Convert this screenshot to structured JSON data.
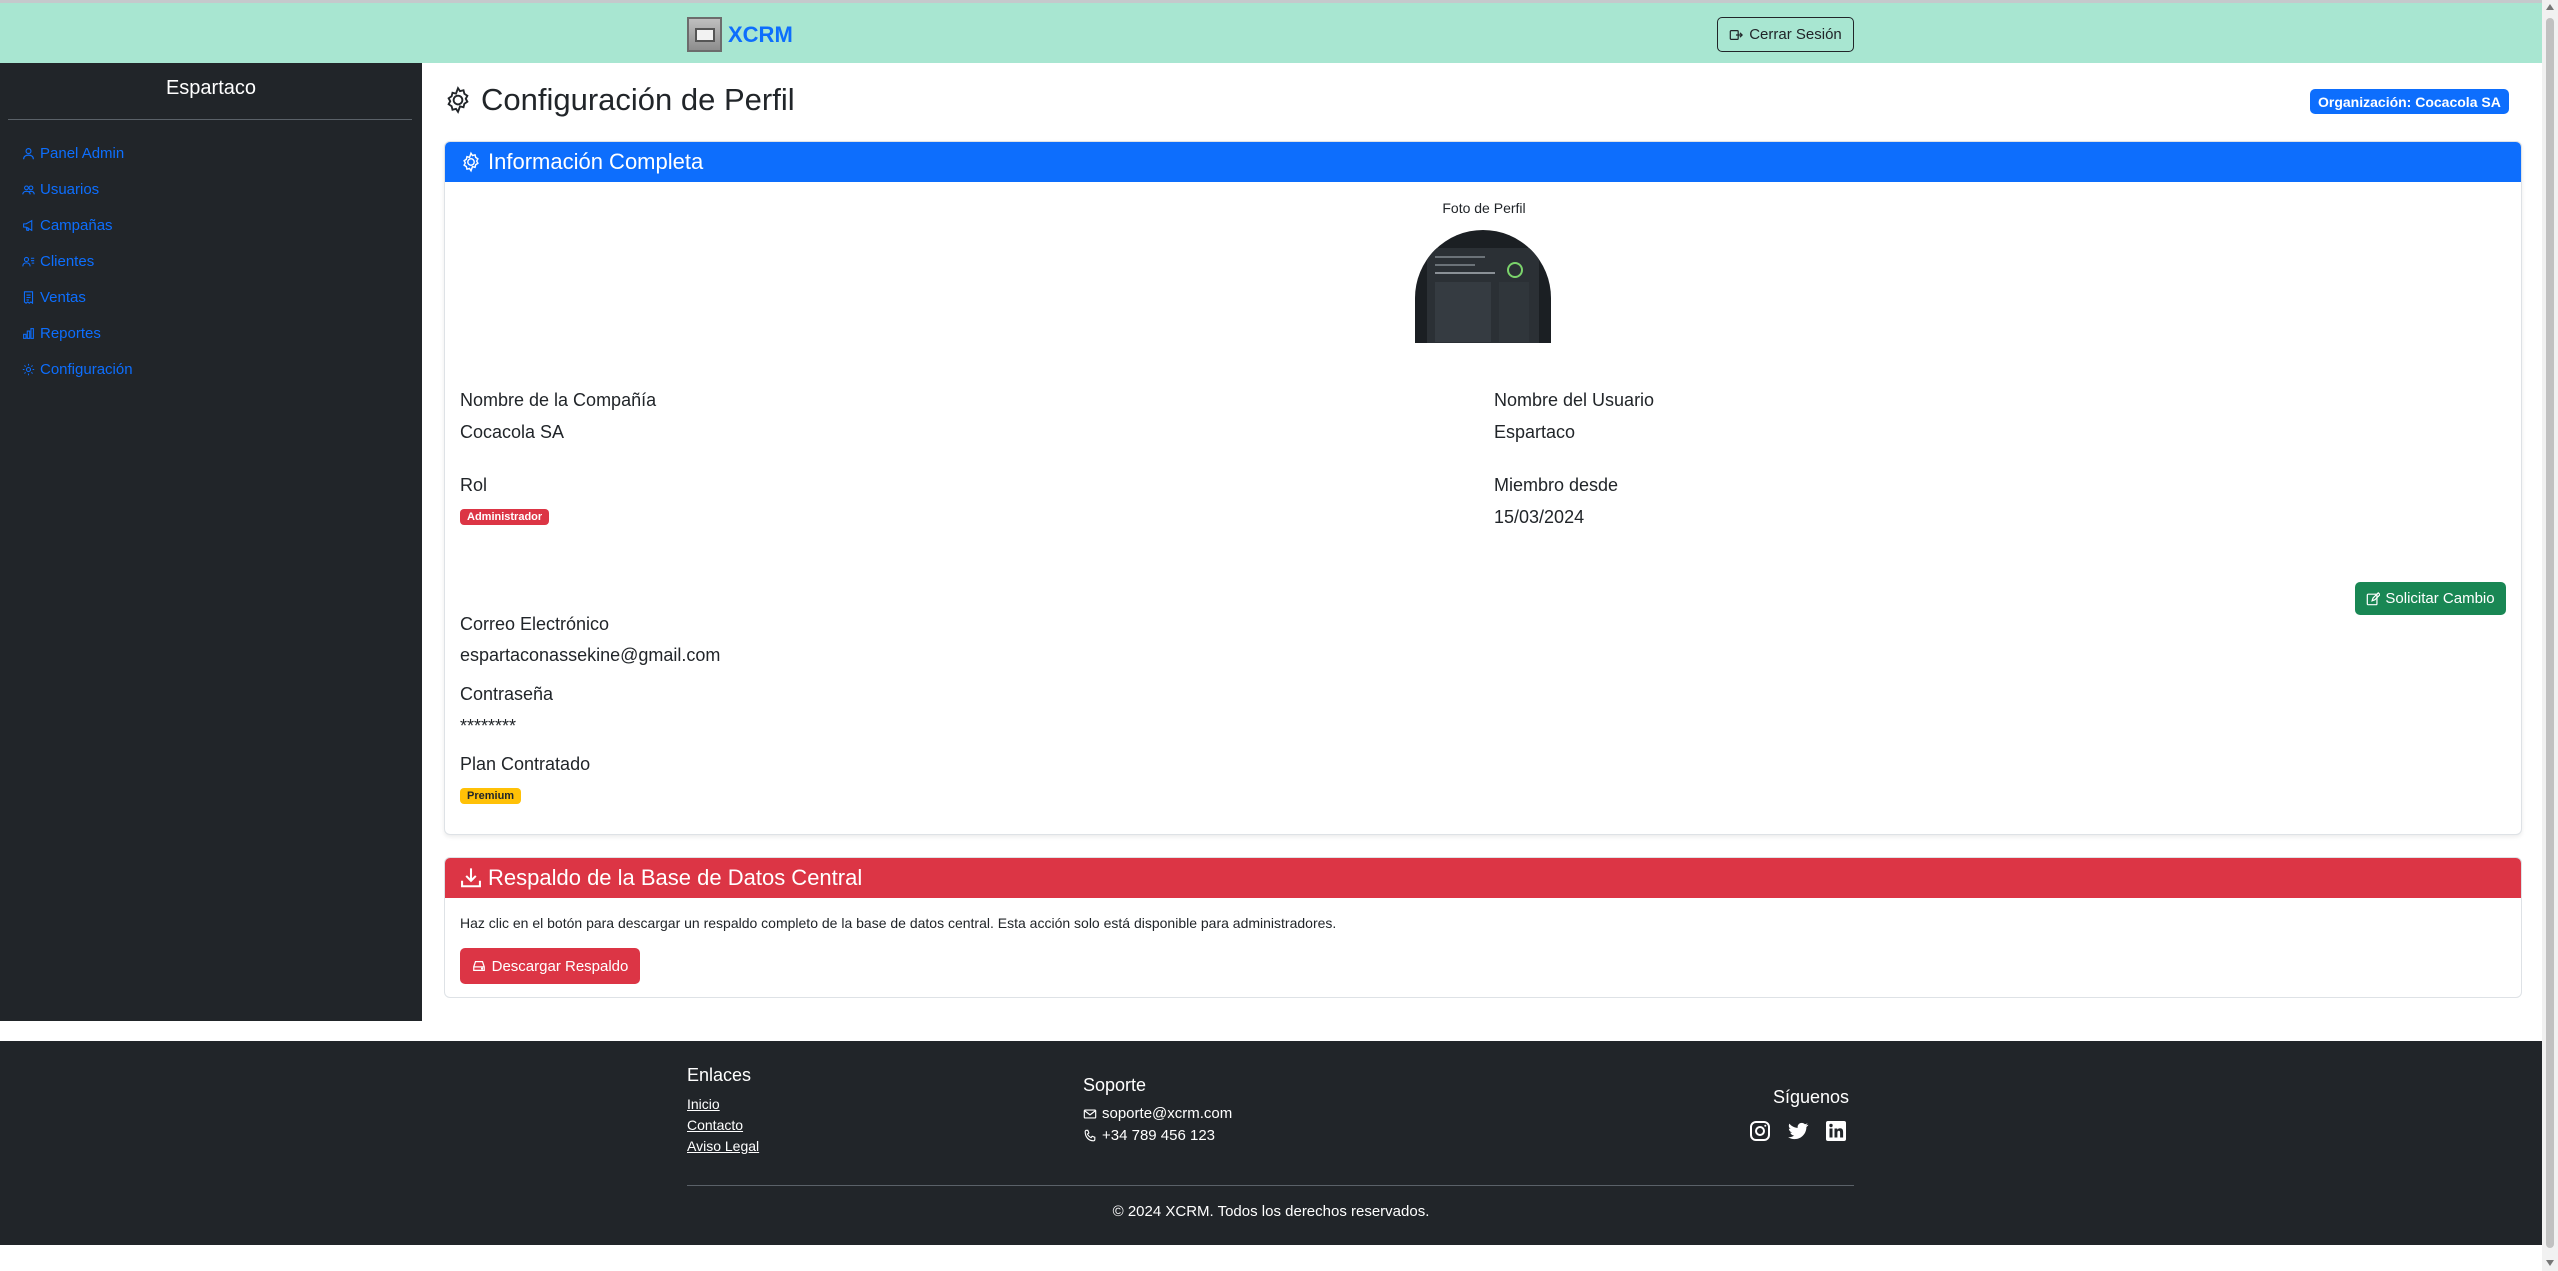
{
  "header": {
    "brand": "XCRM",
    "logout_label": "Cerrar Sesión"
  },
  "sidebar": {
    "title": "Espartaco",
    "items": [
      {
        "label": "Panel Admin",
        "icon": "person-icon"
      },
      {
        "label": "Usuarios",
        "icon": "people-icon"
      },
      {
        "label": "Campañas",
        "icon": "megaphone-icon"
      },
      {
        "label": "Clientes",
        "icon": "person-lines-icon"
      },
      {
        "label": "Ventas",
        "icon": "receipt-icon"
      },
      {
        "label": "Reportes",
        "icon": "bar-chart-icon"
      },
      {
        "label": "Configuración",
        "icon": "gear-icon"
      }
    ]
  },
  "main": {
    "title": "Configuración de Perfil",
    "org_badge": "Organización: Cocacola SA",
    "info_card": {
      "header": "Información Completa",
      "photo_label": "Foto de Perfil",
      "company_label": "Nombre de la Compañía",
      "company_value": "Cocacola SA",
      "user_label": "Nombre del Usuario",
      "user_value": "Espartaco",
      "role_label": "Rol",
      "role_badge": "Administrador",
      "member_label": "Miembro desde",
      "member_value": "15/03/2024",
      "change_button": "Solicitar Cambio",
      "email_label": "Correo Electrónico",
      "email_value": "espartaconassekine@gmail.com",
      "password_label": "Contraseña",
      "password_value": "********",
      "plan_label": "Plan Contratado",
      "plan_badge": "Premium"
    },
    "backup_card": {
      "header": "Respaldo de la Base de Datos Central",
      "description": "Haz clic en el botón para descargar un respaldo completo de la base de datos central. Esta acción solo está disponible para administradores.",
      "button": "Descargar Respaldo"
    }
  },
  "footer": {
    "links_title": "Enlaces",
    "links": [
      "Inicio",
      "Contacto",
      "Aviso Legal"
    ],
    "support_title": "Soporte",
    "support_email": "soporte@xcrm.com",
    "support_phone": "+34 789 456 123",
    "social_title": "Síguenos",
    "socials": [
      "instagram-icon",
      "twitter-icon",
      "linkedin-icon"
    ],
    "copyright": "© 2024 XCRM. Todos los derechos reservados."
  },
  "colors": {
    "topbar": "#a8e6d1",
    "sidebar": "#212529",
    "primary": "#0d6efd",
    "danger": "#dc3545",
    "success": "#198754",
    "warning": "#ffc107"
  }
}
